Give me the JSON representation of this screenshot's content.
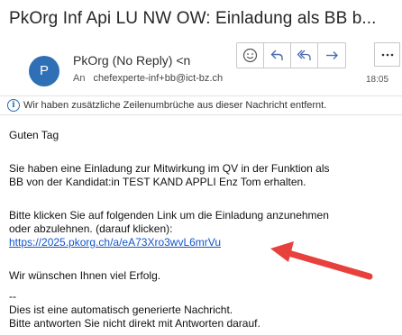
{
  "header": {
    "subject": "PkOrg Inf Api LU NW OW: Einladung als BB b...",
    "avatar_letter": "P",
    "sender": "PkOrg (No Reply) <n",
    "to_label": "An",
    "to_address": "chefexperte-inf+bb@ict-bz.ch",
    "time": "18:05"
  },
  "toolbar": {
    "icons": [
      "smiley-icon",
      "reply-icon",
      "reply-all-icon",
      "forward-icon",
      "more-icon"
    ]
  },
  "info_bar": {
    "text": "Wir haben zusätzliche Zeilenumbrüche aus dieser Nachricht entfernt."
  },
  "body": {
    "greeting": "Guten Tag",
    "para1_line1": "Sie haben eine Einladung zur Mitwirkung im QV in der Funktion als",
    "para1_line2": "BB von der Kandidat:in TEST KAND APPLI Enz Tom erhalten.",
    "para2_line1": "Bitte klicken Sie auf folgenden Link um die Einladung anzunehmen",
    "para2_line2": "oder abzulehnen. (darauf klicken):",
    "link": "https://2025.pkorg.ch/a/eA73Xro3wvL6mrVu",
    "wish": "Wir wünschen Ihnen viel Erfolg.",
    "sig_dash": "--",
    "sig_line1": "Dies ist eine automatisch generierte Nachricht.",
    "sig_line2": "Bitte antworten Sie nicht direkt mit Antworten darauf."
  },
  "colors": {
    "avatar": "#2f6fb6",
    "toolbar_icon": "#4a6fb0",
    "link": "#1155cc",
    "arrow": "#e8413d"
  }
}
